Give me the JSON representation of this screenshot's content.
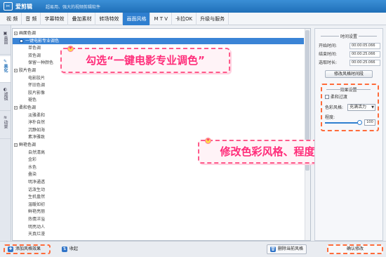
{
  "app": {
    "logo": "✂",
    "name": "爱剪辑",
    "slogan": "超易用、强大的视频剪辑软件"
  },
  "menu": [
    "视 频",
    "音 频",
    "字幕特效",
    "叠加素材",
    "转场特效",
    "画面风格",
    "M T V",
    "卡拉OK",
    "升级与服务"
  ],
  "menu_active": 5,
  "sidetabs": [
    "画面",
    "美化",
    "滤镜",
    "动景"
  ],
  "sidetab_active": 1,
  "list": [
    {
      "type": "cat",
      "label": "画面色调"
    },
    {
      "type": "sel",
      "label": "一键电影专业调色"
    },
    {
      "type": "item",
      "label": "单色调"
    },
    {
      "type": "item",
      "label": "双色调"
    },
    {
      "type": "item",
      "label": "保留一种颜色"
    },
    {
      "type": "cat",
      "label": "胶片色调"
    },
    {
      "type": "item",
      "label": "电影胶片"
    },
    {
      "type": "item",
      "label": "怀旧色调"
    },
    {
      "type": "item",
      "label": "胶片影像"
    },
    {
      "type": "item",
      "label": "褪色"
    },
    {
      "type": "cat",
      "label": "柔和色调"
    },
    {
      "type": "item",
      "label": "淡雅柔和"
    },
    {
      "type": "item",
      "label": "淳朴自然"
    },
    {
      "type": "item",
      "label": "沉静如海"
    },
    {
      "type": "item",
      "label": "素净雅致"
    },
    {
      "type": "cat",
      "label": "鲜艳色调"
    },
    {
      "type": "item",
      "label": "自然清高"
    },
    {
      "type": "item",
      "label": "金彩"
    },
    {
      "type": "item",
      "label": "水色"
    },
    {
      "type": "item",
      "label": "叠染"
    },
    {
      "type": "item",
      "label": "明净通透"
    },
    {
      "type": "item",
      "label": "话泼生动"
    },
    {
      "type": "item",
      "label": "生机盎然"
    },
    {
      "type": "item",
      "label": "温暖如初"
    },
    {
      "type": "item",
      "label": "鲜艳亮丽"
    },
    {
      "type": "item",
      "label": "热情洋溢"
    },
    {
      "type": "item",
      "label": "明亮动人"
    },
    {
      "type": "item",
      "label": "天真烂漫"
    }
  ],
  "callouts": {
    "check": "勾选“一键电影专业调色”",
    "modify": "修改色彩风格、程度"
  },
  "time": {
    "title": "时间设置",
    "rows": [
      {
        "label": "开始时间:",
        "value": "00:00:05.066"
      },
      {
        "label": "结束时间:",
        "value": "00:00:25.066"
      },
      {
        "label": "选取时长:",
        "value": "00:00:25.066"
      }
    ],
    "button": "修改风格时间段"
  },
  "effect": {
    "title": "效果设置",
    "checkbox": "柔和过渡",
    "style_label": "色彩风格:",
    "style_value": "充满活力",
    "degree_label": "程度:",
    "degree_value": "100"
  },
  "bottom": {
    "add": "添加风格效果",
    "collapse": "收起",
    "delete": "删除当前风格",
    "confirm": "确认修改"
  },
  "colors": {
    "accent": "#2f7fd0",
    "callout": "#ff2d7a",
    "dash": "#ff6b3a"
  }
}
